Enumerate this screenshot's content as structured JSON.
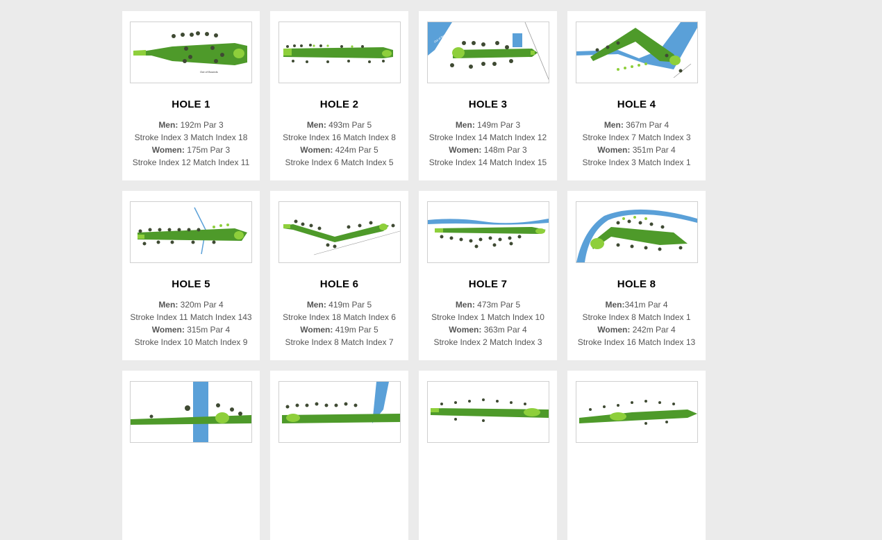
{
  "holes": [
    {
      "title": "HOLE 1",
      "men_label": "Men:",
      "men": " 192m Par 3",
      "men_index": "Stroke Index 3 Match Index 18",
      "women_label": "Women:",
      "women": " 175m Par 3",
      "women_index": "Stroke Index 12 Match Index 11",
      "map_label": "Out of Bounds"
    },
    {
      "title": "HOLE 2",
      "men_label": "Men:",
      "men": " 493m Par 5",
      "men_index": "Stroke Index 16 Match Index 8",
      "women_label": "Women:",
      "women": " 424m Par 5",
      "women_index": "Stroke Index 6 Match Index 5"
    },
    {
      "title": "HOLE 3",
      "men_label": "Men:",
      "men": " 149m Par 3",
      "men_index": "Stroke Index 14 Match Index 12",
      "women_label": "Women:",
      "women": " 148m Par 3",
      "women_index": "Stroke Index 14 Match Index 15",
      "map_label": "Out of Bounds"
    },
    {
      "title": "HOLE 4",
      "men_label": "Men:",
      "men": " 367m Par 4",
      "men_index": "Stroke Index 7 Match Index 3",
      "women_label": "Women:",
      "women": " 351m Par 4",
      "women_index": "Stroke Index 3 Match Index 1"
    },
    {
      "title": "HOLE 5",
      "men_label": "Men:",
      "men": " 320m Par 4",
      "men_index": "Stroke Index 11 Match Index 143",
      "women_label": "Women:",
      "women": " 315m Par 4",
      "women_index": "Stroke Index 10 Match Index 9"
    },
    {
      "title": "HOLE 6",
      "men_label": "Men:",
      "men": " 419m Par 5",
      "men_index": "Stroke Index 18 Match Index 6",
      "women_label": "Women:",
      "women": " 419m Par 5",
      "women_index": "Stroke Index 8 Match Index 7"
    },
    {
      "title": "HOLE 7",
      "men_label": "Men:",
      "men": " 473m Par 5",
      "men_index": "Stroke Index 1 Match Index 10",
      "women_label": "Women:",
      "women": " 363m Par 4",
      "women_index": "Stroke Index 2 Match Index 3"
    },
    {
      "title": "HOLE 8",
      "men_label": "Men:",
      "men": "341m Par 4",
      "men_index": "Stroke Index 8 Match Index 1",
      "women_label": "Women:",
      "women": " 242m Par 4",
      "women_index": "Stroke Index 16 Match Index 13"
    }
  ],
  "colors": {
    "fairway": "#4e9a2a",
    "green": "#8ecf3b",
    "tree": "#3f4a33",
    "water": "#5aa0d8",
    "page_bg": "#ebebeb"
  }
}
